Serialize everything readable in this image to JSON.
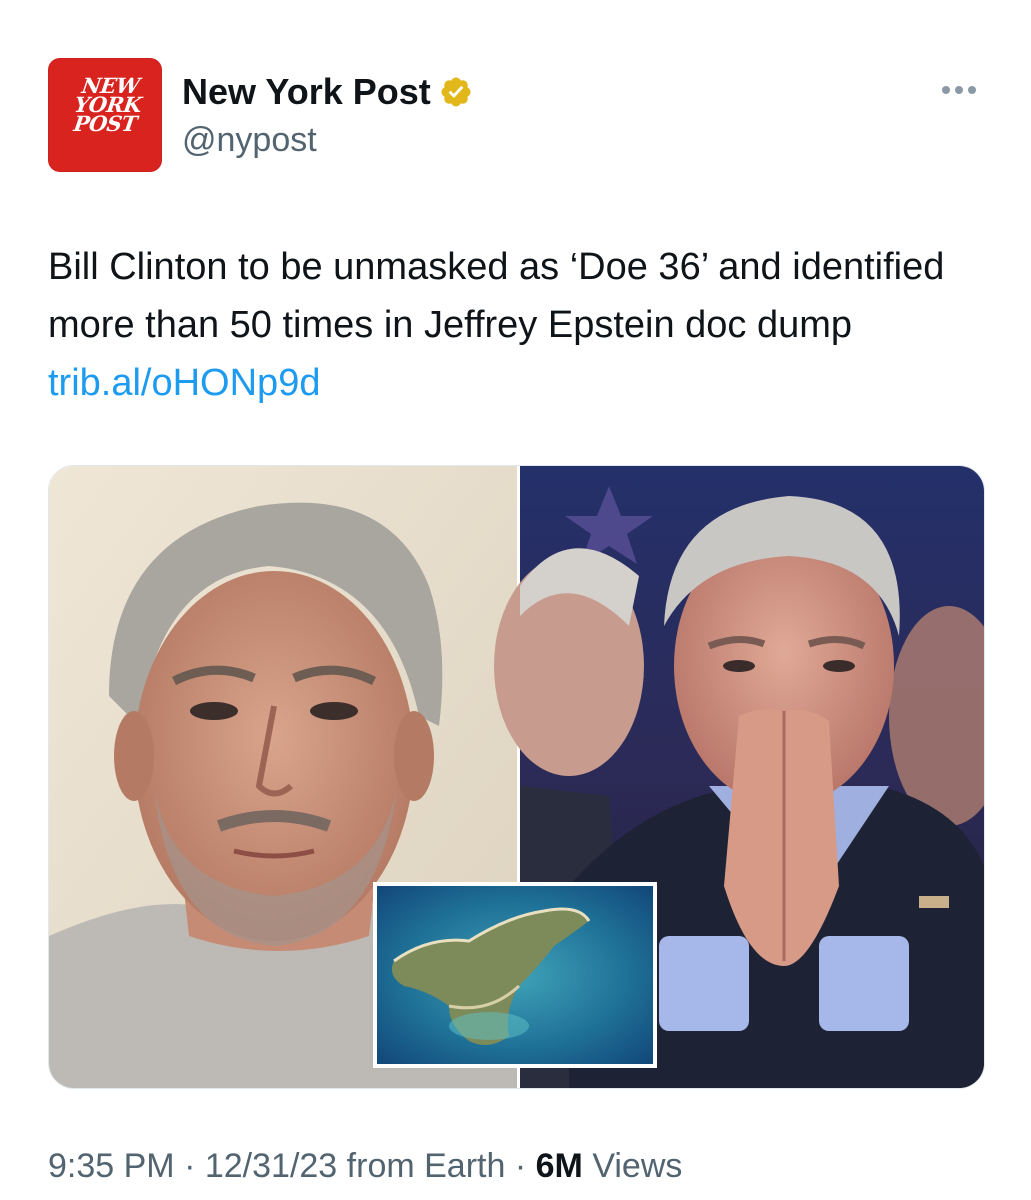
{
  "author": {
    "display_name": "New York Post",
    "handle": "@nypost",
    "verified": true,
    "avatar_logo_lines": [
      "NEW",
      "YORK",
      "POST"
    ],
    "avatar_color": "#d8231f"
  },
  "tweet": {
    "text": "Bill Clinton to be unmasked as ‘Doe 36’ and identified more than 50 times in Jeffrey Epstein doc dump",
    "link": "trib.al/oHONp9d"
  },
  "media": {
    "panels": [
      "jeffrey-epstein-photo",
      "bill-clinton-photo",
      "island-aerial-inset"
    ]
  },
  "meta": {
    "time": "9:35 PM",
    "separator": "·",
    "date": "12/31/23",
    "source": "from Earth",
    "views_count": "6M",
    "views_label": "Views"
  },
  "colors": {
    "link": "#1d9bf0",
    "secondary_text": "#536471",
    "verified_badge": "#e2b719"
  },
  "icons": {
    "verified": "verified-badge-icon",
    "more": "more-icon"
  }
}
